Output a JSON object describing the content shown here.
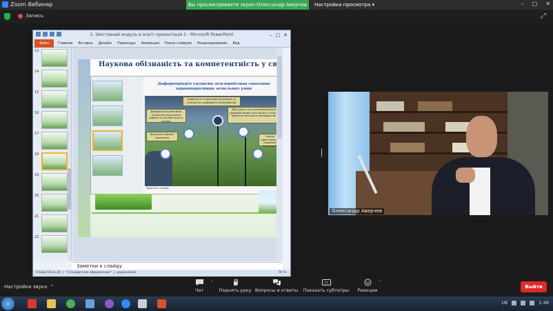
{
  "titlebar": {
    "app_title": "Zoom Вебинар",
    "share_banner": "Вы просматриваете экран Олександр Аверчев",
    "view_options": "Настройки просмотра",
    "window_controls": [
      "–",
      "□",
      "✕"
    ]
  },
  "recording": {
    "label": "Запись"
  },
  "powerpoint": {
    "window_title": "2. Змістовний модуль в освіті презентація 2 - Microsoft PowerPoint",
    "file_tab": "Файл",
    "ribbon_tabs": [
      "Главная",
      "Вставка",
      "Дизайн",
      "Переходы",
      "Анимация",
      "Показ слайдов",
      "Рецензирование",
      "Вид"
    ],
    "thumb_numbers": [
      "13",
      "14",
      "15",
      "16",
      "17",
      "18",
      "19",
      "20",
      "21",
      "22"
    ],
    "selected_thumb": "18",
    "slide": {
      "title": "Наукова обізнаність та компетентність у своїй робо",
      "inner_heading": "Диференціація системи землеробства стосовно характеристики земельних умов",
      "boxes": [
        "Прийняття та визначення ділянок та сенсорного цифрового землеробства",
        "Диференціальний облік кількісних показників добрив та засобів захисту рослин",
        "Збір даних та їх систематизація в цифровій моделі для оцінки точності ведення сільського господарства",
        "Візуально вибрані параметри",
        "Оцінка ефективності цифрових технологій"
      ],
      "node_numbers": [
        "1",
        "2",
        "3",
        "4",
        "5"
      ],
      "inner_caption": "Заметки к слайду"
    },
    "notes_placeholder": "Заметки к слайду",
    "status": {
      "slide_info": "Слайд 18 из 20",
      "theme": "\"Стандартное оформление\"",
      "language": "украинский",
      "zoom": "76 %"
    }
  },
  "video": {
    "participant_name": "Олександр Аверчев"
  },
  "toolbar": {
    "audio_settings": "Настройки звука",
    "items": [
      {
        "label": "Чат"
      },
      {
        "label": "Поднять руку"
      },
      {
        "label": "Вопросы и ответы"
      },
      {
        "label": "Показать субтитры"
      },
      {
        "label": "Реакции"
      }
    ],
    "leave": "Выйти"
  },
  "taskbar": {
    "language": "UK",
    "time": "1:48"
  },
  "colors": {
    "share_banner": "#3aa655",
    "leave_button": "#e02828",
    "ppt_file_tab": "#d2542a"
  }
}
